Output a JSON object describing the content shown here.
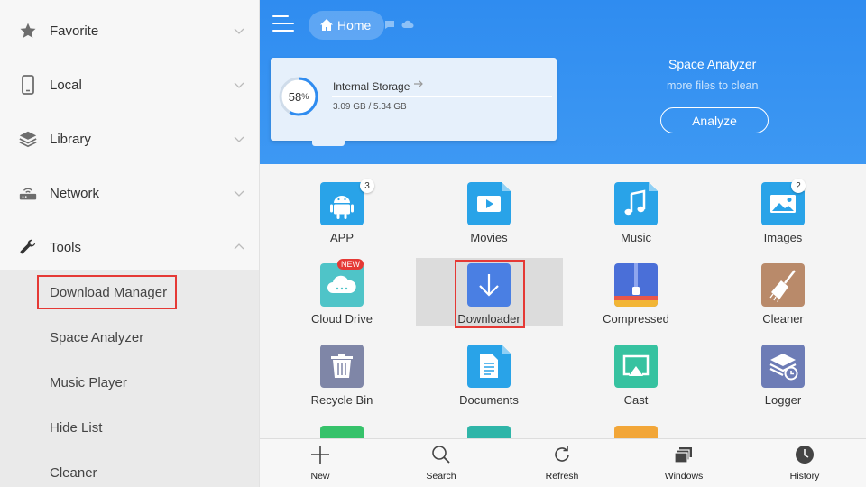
{
  "sidebar": {
    "items": [
      {
        "label": "Favorite",
        "icon": "star-icon"
      },
      {
        "label": "Local",
        "icon": "phone-icon"
      },
      {
        "label": "Library",
        "icon": "layers-icon"
      },
      {
        "label": "Network",
        "icon": "router-icon"
      },
      {
        "label": "Tools",
        "icon": "wrench-icon"
      }
    ],
    "tools_sub": [
      "Download Manager",
      "Space Analyzer",
      "Music Player",
      "Hide List",
      "Cleaner"
    ]
  },
  "header": {
    "home_label": "Home"
  },
  "storage": {
    "percent_text": "58",
    "percent_sign": "%",
    "percent_value": 58,
    "title": "Internal Storage",
    "size": "3.09 GB / 5.34 GB"
  },
  "space_analyzer": {
    "title": "Space Analyzer",
    "subtitle": "more files to clean",
    "button": "Analyze"
  },
  "grid": {
    "items": [
      {
        "label": "APP",
        "badge": "3"
      },
      {
        "label": "Movies"
      },
      {
        "label": "Music"
      },
      {
        "label": "Images",
        "badge": "2"
      },
      {
        "label": "Cloud Drive",
        "tag": "NEW"
      },
      {
        "label": "Downloader"
      },
      {
        "label": "Compressed"
      },
      {
        "label": "Cleaner"
      },
      {
        "label": "Recycle Bin"
      },
      {
        "label": "Documents"
      },
      {
        "label": "Cast"
      },
      {
        "label": "Logger"
      }
    ]
  },
  "bottom_bar": {
    "items": [
      "New",
      "Search",
      "Refresh",
      "Windows",
      "History"
    ]
  },
  "colors": {
    "header_blue": "#2f8cf0",
    "highlight_red": "#e53935",
    "icon_blue": "#2a9ee8"
  }
}
